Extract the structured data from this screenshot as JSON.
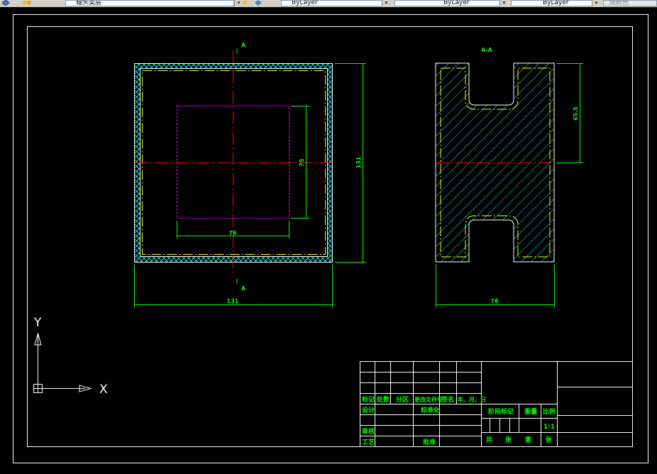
{
  "toolbar": {
    "layer_name": "轴头类层",
    "color": "ByLayer",
    "linetype": "ByLayer",
    "lineweight": "ByLayer",
    "plot_style": "随颜色"
  },
  "drawing": {
    "section_top_label": "A",
    "section_bottom_label": "A",
    "section_view_title": "A-A",
    "dim_width_front": "131",
    "dim_height_front": "131",
    "dim_inner_width": "76",
    "dim_inner_height": "75",
    "dim_width_side": "78",
    "dim_slot_depth": "65.5"
  },
  "ucs": {
    "x_label": "X",
    "y_label": "Y"
  },
  "title_block": {
    "mark": "标记",
    "count": "处数",
    "zone": "分区",
    "change_doc": "更改文件号",
    "sign": "签名",
    "date": "年、月、日",
    "design": "设计",
    "standardize": "标准化",
    "check": "审核",
    "process": "工艺",
    "approve": "批准",
    "stage_mark": "阶段标记",
    "weight": "重量",
    "scale": "比例",
    "scale_value": "1:1",
    "total": "共",
    "sheets": "张",
    "page": "第",
    "sheet2": "张"
  },
  "colors": {
    "green": "#00ff00",
    "cyan": "#00ffff",
    "red": "#ff0000",
    "magenta": "#ff00ff",
    "yellow": "#ffff00",
    "white": "#ffffff"
  }
}
